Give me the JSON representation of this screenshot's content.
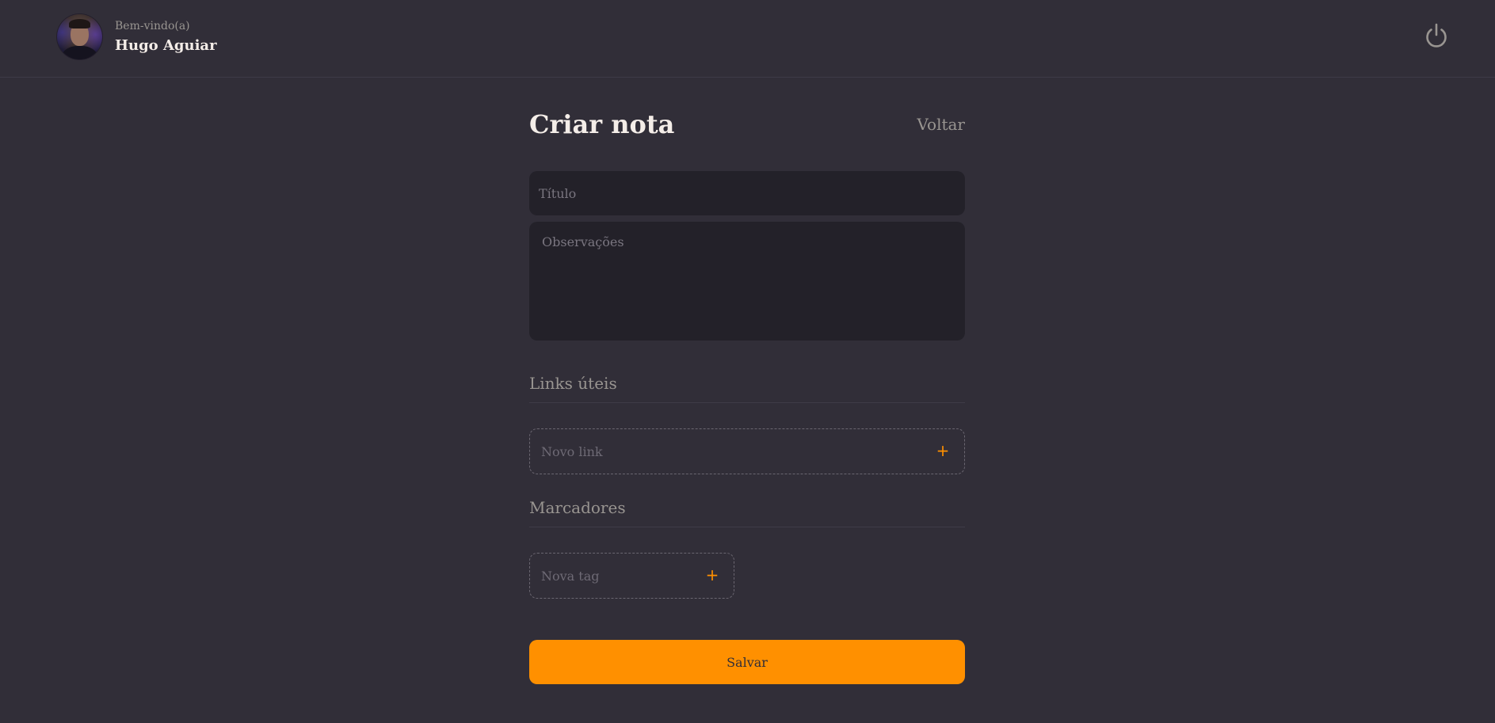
{
  "header": {
    "welcome_text": "Bem-vindo(a)",
    "user_name": "Hugo Aguiar",
    "avatar": "avatar-photo",
    "power_icon": "power-icon"
  },
  "page": {
    "title": "Criar nota",
    "back_label": "Voltar"
  },
  "form": {
    "title_placeholder": "Título",
    "title_value": "",
    "notes_placeholder": "Observações",
    "notes_value": ""
  },
  "links_section": {
    "title": "Links úteis",
    "new_link_placeholder": "Novo link",
    "add_icon": "+"
  },
  "tags_section": {
    "title": "Marcadores",
    "new_tag_placeholder": "Nova tag",
    "add_icon": "+"
  },
  "actions": {
    "save_label": "Salvar"
  },
  "colors": {
    "background": "#312e38",
    "input_background": "#232129",
    "accent": "#ff9000",
    "text_primary": "#f4ede8",
    "text_secondary": "#999591"
  }
}
